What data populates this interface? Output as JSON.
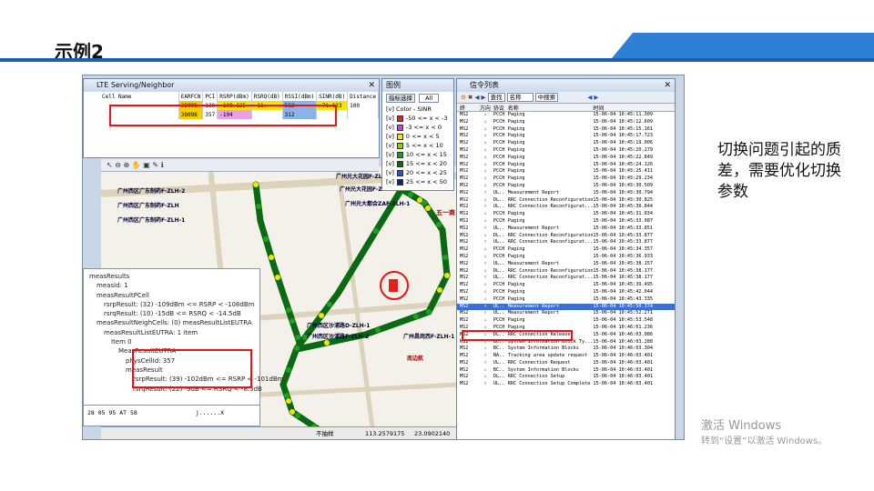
{
  "slide": {
    "title": "示例2",
    "side_text": "切换问题引起的质差，需要优化切换参数",
    "watermark_line1": "激活 Windows",
    "watermark_line2": "转到“设置”以激活 Windows。"
  },
  "serving": {
    "title": "LTE Serving/Neighbor",
    "columns": [
      "Cell Name",
      "EARFCN",
      "PCI",
      "RSRP(dBm)",
      "RSRQ(dB)",
      "RSSI(dBm)",
      "SINR(dB)",
      "Distance"
    ],
    "rows": [
      [
        "",
        "38098",
        "138",
        "-108.125",
        "-11.",
        "562",
        "-71.133",
        "100"
      ],
      [
        "",
        "38098",
        "357",
        "-104",
        "",
        "312",
        "",
        ""
      ]
    ]
  },
  "legend": {
    "title": "图例",
    "button": "指标选择",
    "select_value": "All",
    "header": "Color - SINR",
    "items": [
      {
        "label": "-50 <= x < -3",
        "color": "#e32020"
      },
      {
        "label": "-3 <= x < 0",
        "color": "#d040d0"
      },
      {
        "label": "0 <= x < 5",
        "color": "#f2e600"
      },
      {
        "label": "5 <= x < 10",
        "color": "#8bd400"
      },
      {
        "label": "10 <= x < 15",
        "color": "#1ea01e"
      },
      {
        "label": "15 <= x < 20",
        "color": "#0a6a14"
      },
      {
        "label": "20 <= x < 25",
        "color": "#2c50d8"
      },
      {
        "label": "25 <= x < 50",
        "color": "#1c1c90"
      }
    ]
  },
  "map": {
    "labels": [
      "广州西区广东制药F-ZLH-2",
      "广州西区广东制药F-ZLH",
      "广州西区广东制药F-ZLH-1",
      "广州光大花园F-ZLH-2",
      "广州光大花园F-ZLH-1",
      "广州光大都会ZAF-ZLH-1",
      "广州西区沙浦路D-ZLH-1",
      "广州西区沙浦路F-ZLH-2",
      "五一商",
      "广州昌岗西F-ZLH-1",
      "南边航"
    ],
    "status_left": "不抽样",
    "status_x": "113.2579175",
    "status_y": "23.0902140"
  },
  "tree": {
    "lines": [
      "measResults",
      "measId: 1",
      "measResultPCell",
      "rsrpResult: (32) -109dBm <= RSRP < -108dBm",
      "rsrqResult: (10) -15dB <= RSRQ < -14.5dB",
      "measResultNeighCells: (0) measResultListEUTRA",
      "measResultListEUTRA: 1 item",
      "Item 0",
      "MeasResultEUTRA",
      "physCellId: 357",
      "measResult",
      "rsrpResult: (39) -102dBm <= RSRP < -101dBm",
      "rsrqResult: (22) -9dB <= RSRQ < -8.5dB"
    ],
    "hex_text": "28 05 95 AT 58",
    "hex_ascii": "j......X"
  },
  "signal": {
    "title": "信令列表",
    "toolbar_btn1": "查找",
    "toolbar_btn2": "名称",
    "toolbar_btn3": "中搜索",
    "columns": [
      "终",
      "方向",
      "协议",
      "名称",
      "时间"
    ],
    "rows": [
      [
        "MS2",
        "↓",
        "PCCH",
        "Paging",
        "15-06-04 10:45:11.309"
      ],
      [
        "MS2",
        "↓",
        "PCCH",
        "Paging",
        "15-06-04 10:45:12.609"
      ],
      [
        "MS2",
        "↓",
        "PCCH",
        "Paging",
        "15-06-04 10:45:15.161"
      ],
      [
        "MS2",
        "↓",
        "PCCH",
        "Paging",
        "15-06-04 10:45:17.723"
      ],
      [
        "MS2",
        "↓",
        "PCCH",
        "Paging",
        "15-06-04 10:45:19.006"
      ],
      [
        "MS2",
        "↓",
        "PCCH",
        "Paging",
        "15-06-04 10:45:20.279"
      ],
      [
        "MS2",
        "↓",
        "PCCH",
        "Paging",
        "15-06-04 10:45:22.849"
      ],
      [
        "MS2",
        "↓",
        "PCCH",
        "Paging",
        "15-06-04 10:45:24.126"
      ],
      [
        "MS2",
        "↓",
        "PCCH",
        "Paging",
        "15-06-04 10:45:25.411"
      ],
      [
        "MS2",
        "↓",
        "PCCH",
        "Paging",
        "15-06-04 10:45:29.234"
      ],
      [
        "MS2",
        "↓",
        "PCCH",
        "Paging",
        "15-06-04 10:45:30.509"
      ],
      [
        "MS2",
        "↑",
        "UL..",
        "Measurement Report",
        "15-06-04 10:45:30.794"
      ],
      [
        "MS2",
        "↓",
        "DL..",
        "RRC Connection Reconfiguration",
        "15-06-04 10:45:30.825"
      ],
      [
        "MS2",
        "↑",
        "UL..",
        "RRC Connection Reconfigurat...",
        "15-06-04 10:45:30.844"
      ],
      [
        "MS2",
        "↓",
        "PCCH",
        "Paging",
        "15-06-04 10:45:31.834"
      ],
      [
        "MS2",
        "↓",
        "PCCH",
        "Paging",
        "15-06-04 10:45:33.087"
      ],
      [
        "MS2",
        "↑",
        "UL..",
        "Measurement Report",
        "15-06-04 10:45:33.851"
      ],
      [
        "MS2",
        "↓",
        "DL..",
        "RRC Connection Reconfiguration",
        "15-06-04 10:45:33.877"
      ],
      [
        "MS2",
        "↑",
        "UL..",
        "RRC Connection Reconfigurat...",
        "15-06-04 10:45:33.877"
      ],
      [
        "MS2",
        "↓",
        "PCCH",
        "Paging",
        "15-06-04 10:45:34.357"
      ],
      [
        "MS2",
        "↓",
        "PCCH",
        "Paging",
        "15-06-04 10:45:36.933"
      ],
      [
        "MS2",
        "↑",
        "UL..",
        "Measurement Report",
        "15-06-04 10:45:38.157"
      ],
      [
        "MS2",
        "↓",
        "DL..",
        "RRC Connection Reconfiguration",
        "15-06-04 10:45:38.177"
      ],
      [
        "MS2",
        "↑",
        "UL..",
        "RRC Connection Reconfigurat...",
        "15-06-04 10:45:38.177"
      ],
      [
        "MS2",
        "↓",
        "PCCH",
        "Paging",
        "15-06-04 10:45:39.495"
      ],
      [
        "MS2",
        "↓",
        "PCCH",
        "Paging",
        "15-06-04 10:45:42.044"
      ],
      [
        "MS2",
        "↓",
        "PCCH",
        "Paging",
        "15-06-04 10:45:43.335"
      ],
      [
        "MS2",
        "↑",
        "UL..",
        "Measurement Report",
        "15-06-04 10:45:50.374"
      ],
      [
        "MS2",
        "↑",
        "UL..",
        "Measurement Report",
        "15-06-04 10:45:52.271"
      ],
      [
        "MS2",
        "↓",
        "PCCH",
        "Paging",
        "15-06-04 10:45:53.548"
      ],
      [
        "MS2",
        "↓",
        "PCCH",
        "Paging",
        "15-06-04 10:46:01.236"
      ],
      [
        "MS2",
        "↓",
        "DL..",
        "RRC Connection Release",
        "15-06-04 10:46:03.086"
      ],
      [
        "MS2",
        "↓",
        "BC..",
        "System Information Block Ty...",
        "15-06-04 10:46:03.288"
      ],
      [
        "MS2",
        "↓",
        "BC..",
        "System Information Blocks",
        "15-06-04 10:46:03.304"
      ],
      [
        "MS2",
        "↑",
        "NA..",
        "Tracking area update request",
        "15-06-04 10:46:03.401"
      ],
      [
        "MS2",
        "↑",
        "UL..",
        "RRC Connection Request",
        "15-06-04 10:46:03.401"
      ],
      [
        "MS2",
        "↓",
        "BC..",
        "System Information Blocks",
        "15-06-04 10:46:03.401"
      ],
      [
        "MS2",
        "↓",
        "DL..",
        "RRC Connection Setup",
        "15-06-04 10:46:03.401"
      ],
      [
        "MS2",
        "↑",
        "UL..",
        "RRC Connection Setup Complete",
        "15-06-04 10:46:03.401"
      ]
    ],
    "highlight_index": 27
  }
}
